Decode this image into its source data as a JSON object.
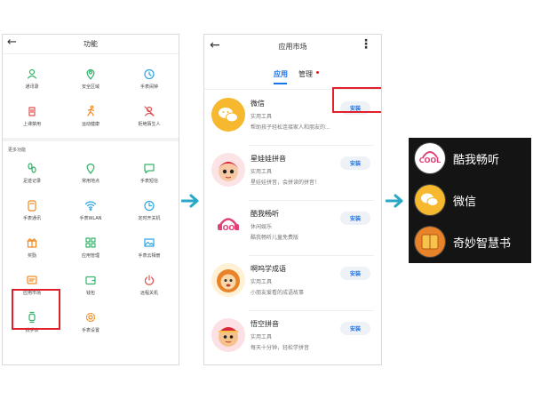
{
  "functions_screen": {
    "title": "功能",
    "back_icon": "back-arrow-icon",
    "top_items": [
      {
        "label": "通讯录",
        "icon": "contacts-icon",
        "color": "#34b36b"
      },
      {
        "label": "安全区域",
        "icon": "location-pin-icon",
        "color": "#34b36b"
      },
      {
        "label": "手表闹钟",
        "icon": "alarm-clock-icon",
        "color": "#2fa6e0"
      },
      {
        "label": "上课禁用",
        "icon": "class-mode-icon",
        "color": "#e05050"
      },
      {
        "label": "运动健康",
        "icon": "running-icon",
        "color": "#f08a24"
      },
      {
        "label": "拒绝陌生人",
        "icon": "block-stranger-icon",
        "color": "#e05050"
      }
    ],
    "section_title": "更多功能",
    "more_items": [
      {
        "label": "足迹记录",
        "icon": "footprint-icon",
        "color": "#34b36b"
      },
      {
        "label": "常用地点",
        "icon": "place-pin-icon",
        "color": "#34b36b"
      },
      {
        "label": "手表短信",
        "icon": "sms-icon",
        "color": "#34b36b"
      },
      {
        "label": "手表通讯",
        "icon": "watch-phone-icon",
        "color": "#f08a24"
      },
      {
        "label": "手表WLAN",
        "icon": "wifi-icon",
        "color": "#2fa6e0"
      },
      {
        "label": "定时开关机",
        "icon": "timer-icon",
        "color": "#2fa6e0"
      },
      {
        "label": "奖励",
        "icon": "reward-icon",
        "color": "#f08a24"
      },
      {
        "label": "应用管理",
        "icon": "app-manage-icon",
        "color": "#34b36b"
      },
      {
        "label": "手表云相册",
        "icon": "photo-album-icon",
        "color": "#2fa6e0"
      },
      {
        "label": "应用市场",
        "icon": "app-market-icon",
        "color": "#f08a24"
      },
      {
        "label": "钱包",
        "icon": "wallet-icon",
        "color": "#34b36b"
      },
      {
        "label": "远程关机",
        "icon": "power-icon",
        "color": "#e05050"
      },
      {
        "label": "找手表",
        "icon": "find-watch-icon",
        "color": "#34b36b"
      },
      {
        "label": "手表设置",
        "icon": "settings-gear-icon",
        "color": "#f08a24"
      }
    ]
  },
  "app_market": {
    "title": "应用市场",
    "more_icon": "more-vertical-icon",
    "tabs": [
      {
        "label": "应用",
        "active": true
      },
      {
        "label": "管理",
        "active": false,
        "badge": "red-dot"
      }
    ],
    "install_label": "安装",
    "apps": [
      {
        "name": "微信",
        "category": "实用工具",
        "description": "帮助孩子轻松连接家人和朋友的...",
        "icon": "wechat-icon"
      },
      {
        "name": "星娃娃拼音",
        "category": "实用工具",
        "description": "星娃娃拼音，会拼读的拼音！",
        "icon": "xingwawa-pinyin-icon"
      },
      {
        "name": "酷我畅听",
        "category": "休闲娱乐",
        "description": "酷我畅听儿童免费版",
        "icon": "kuwo-cool-icon"
      },
      {
        "name": "啊呜学成语",
        "category": "实用工具",
        "description": "小朋友爱看的成语故事",
        "icon": "awu-idiom-icon"
      },
      {
        "name": "悟空拼音",
        "category": "实用工具",
        "description": "每天十分钟，轻松学拼音",
        "icon": "wukong-pinyin-icon"
      }
    ]
  },
  "watch_screen": {
    "apps": [
      {
        "name": "酷我畅听",
        "icon": "kuwo-cool-icon"
      },
      {
        "name": "微信",
        "icon": "wechat-icon"
      },
      {
        "name": "奇妙智慧书",
        "icon": "wisdom-book-icon"
      }
    ]
  },
  "colors": {
    "accent_blue": "#1a74e8",
    "highlight_red": "#e0202a",
    "arrow_teal": "#29a7c4",
    "watch_bg": "#141414"
  }
}
